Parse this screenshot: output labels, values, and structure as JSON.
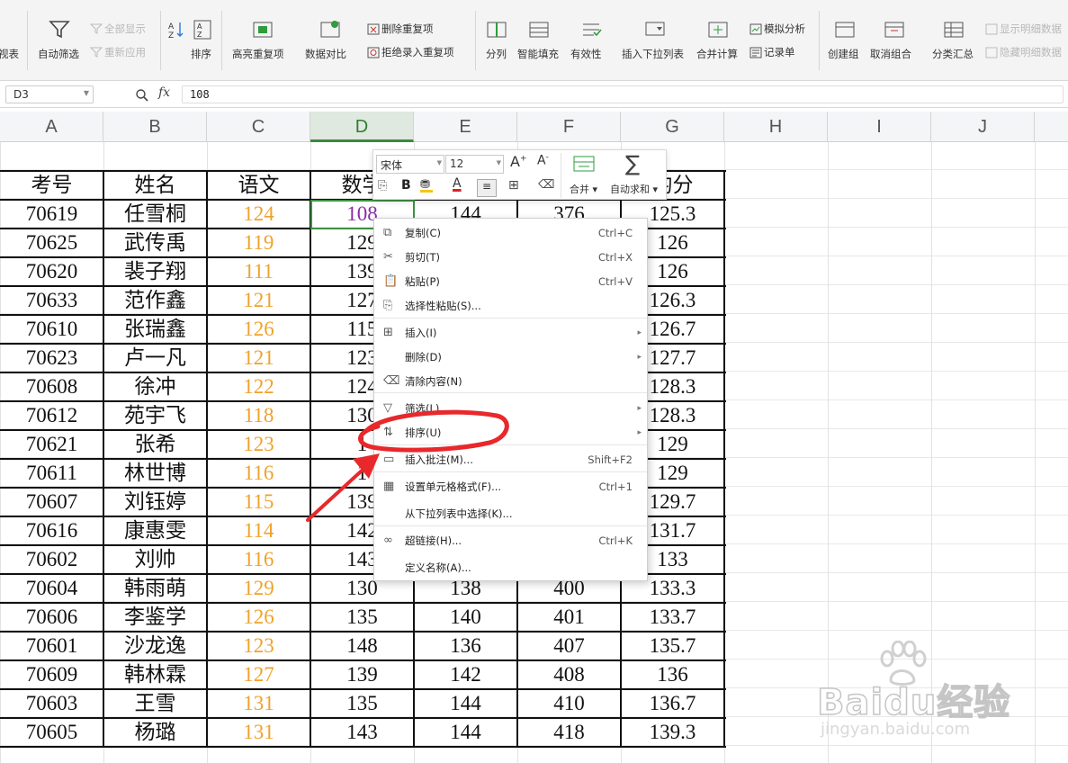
{
  "ribbon": {
    "partial_left": "视表",
    "auto_filter": "自动筛选",
    "show_all": "全部显示",
    "reapply": "重新应用",
    "sort": "排序",
    "highlight_dup": "高亮重复项",
    "data_compare": "数据对比",
    "delete_dup": "删除重复项",
    "reject_dup": "拒绝录入重复项",
    "split": "分列",
    "smart_fill": "智能填充",
    "validity": "有效性",
    "insert_dropdown": "插入下拉列表",
    "merge_calc": "合并计算",
    "simulate": "模拟分析",
    "record": "记录单",
    "create_group": "创建组",
    "ungroup": "取消组合",
    "subtotal": "分类汇总",
    "show_detail": "显示明细数据",
    "hide_detail": "隐藏明细数据"
  },
  "formula_bar": {
    "cell_ref": "D3",
    "fx": "fx",
    "value": "108"
  },
  "columns": [
    "A",
    "B",
    "C",
    "D",
    "E",
    "F",
    "G",
    "H",
    "I",
    "J"
  ],
  "active_column": "D",
  "table": {
    "headers": [
      "考号",
      "姓名",
      "语文",
      "数学",
      "",
      "",
      "均分"
    ],
    "rows": [
      [
        "70619",
        "任雪桐",
        "124",
        "108",
        "144",
        "376",
        "125.3"
      ],
      [
        "70625",
        "武传禹",
        "119",
        "129",
        "",
        "",
        "126"
      ],
      [
        "70620",
        "裴子翔",
        "111",
        "139",
        "",
        "",
        "126"
      ],
      [
        "70633",
        "范作鑫",
        "121",
        "127",
        "",
        "",
        "126.3"
      ],
      [
        "70610",
        "张瑞鑫",
        "126",
        "115",
        "",
        "",
        "126.7"
      ],
      [
        "70623",
        "卢一凡",
        "121",
        "123",
        "",
        "",
        "127.7"
      ],
      [
        "70608",
        "徐冲",
        "122",
        "124",
        "",
        "",
        "128.3"
      ],
      [
        "70612",
        "苑宇飞",
        "118",
        "130",
        "",
        "",
        "128.3"
      ],
      [
        "70621",
        "张希",
        "123",
        "1",
        "",
        "",
        "129"
      ],
      [
        "70611",
        "林世博",
        "116",
        "1",
        "",
        "",
        "129"
      ],
      [
        "70607",
        "刘钰婷",
        "115",
        "139",
        "",
        "",
        "129.7"
      ],
      [
        "70616",
        "康惠雯",
        "114",
        "142",
        "",
        "",
        "131.7"
      ],
      [
        "70602",
        "刘帅",
        "116",
        "143",
        "",
        "",
        "133"
      ],
      [
        "70604",
        "韩雨萌",
        "129",
        "130",
        "138",
        "400",
        "133.3"
      ],
      [
        "70606",
        "李鉴学",
        "126",
        "135",
        "140",
        "401",
        "133.7"
      ],
      [
        "70601",
        "沙龙逸",
        "123",
        "148",
        "136",
        "407",
        "135.7"
      ],
      [
        "70609",
        "韩林霖",
        "127",
        "139",
        "142",
        "408",
        "136"
      ],
      [
        "70603",
        "王雪",
        "131",
        "135",
        "144",
        "410",
        "136.7"
      ],
      [
        "70605",
        "杨璐",
        "131",
        "143",
        "144",
        "418",
        "139.3"
      ]
    ]
  },
  "minibar": {
    "font": "宋体",
    "size": "12",
    "merge": "合并",
    "autosum": "自动求和",
    "bold": "B"
  },
  "context_menu": [
    {
      "label": "复制(C)",
      "shortcut": "Ctrl+C"
    },
    {
      "label": "剪切(T)",
      "shortcut": "Ctrl+X"
    },
    {
      "label": "粘贴(P)",
      "shortcut": "Ctrl+V"
    },
    {
      "label": "选择性粘贴(S)...",
      "shortcut": ""
    },
    {
      "label": "插入(I)",
      "shortcut": ""
    },
    {
      "label": "删除(D)",
      "shortcut": ""
    },
    {
      "label": "清除内容(N)",
      "shortcut": ""
    },
    {
      "label": "筛选(L)",
      "shortcut": ""
    },
    {
      "label": "排序(U)",
      "shortcut": ""
    },
    {
      "label": "插入批注(M)...",
      "shortcut": "Shift+F2"
    },
    {
      "label": "设置单元格格式(F)...",
      "shortcut": "Ctrl+1"
    },
    {
      "label": "从下拉列表中选择(K)...",
      "shortcut": ""
    },
    {
      "label": "超链接(H)...",
      "shortcut": "Ctrl+K"
    },
    {
      "label": "定义名称(A)...",
      "shortcut": ""
    }
  ],
  "watermark": {
    "brand": "Baidu经验",
    "url": "jingyan.baidu.com"
  },
  "colors": {
    "orange": "#f0a22b",
    "purple": "#8b2ca6",
    "selection": "#3f9142",
    "annotation_red": "#e8282b"
  }
}
